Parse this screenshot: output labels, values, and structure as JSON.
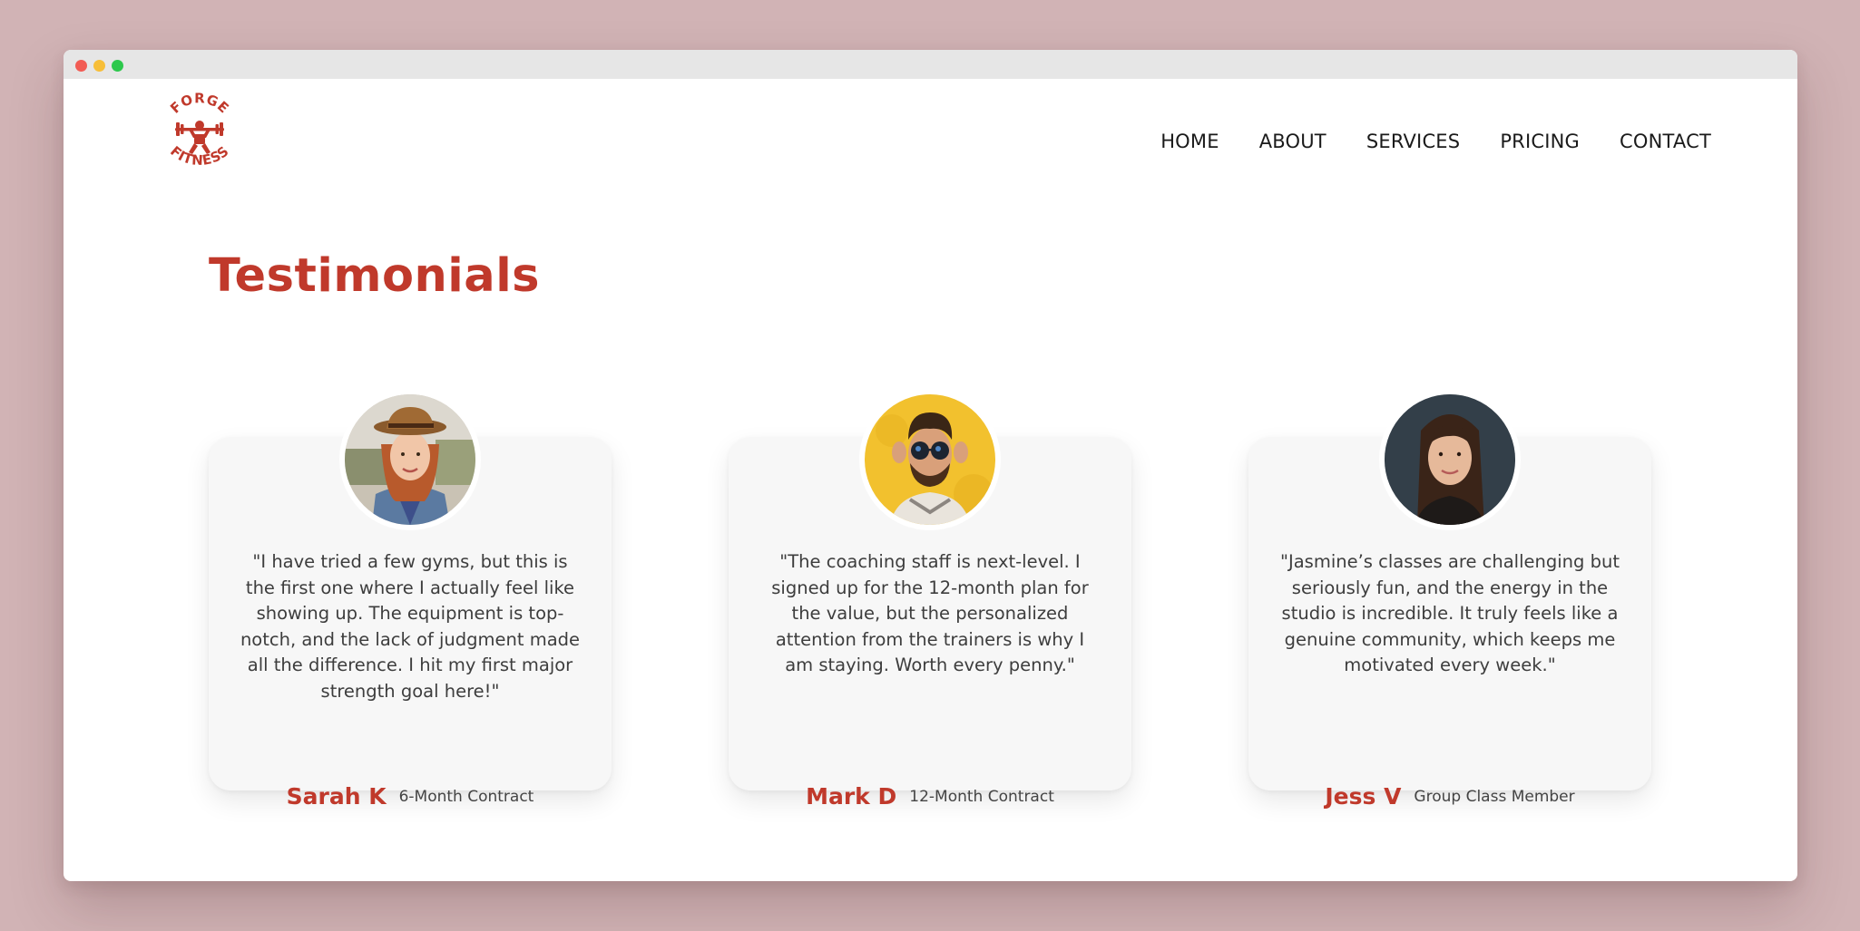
{
  "window": {
    "traffic_lights": [
      "close",
      "minimize",
      "maximize"
    ]
  },
  "logo": {
    "top_text": "FORGE",
    "bottom_text": "FITNESS",
    "icon": "weightlifter-icon",
    "color": "#c0392b"
  },
  "nav": {
    "items": [
      "HOME",
      "ABOUT",
      "SERVICES",
      "PRICING",
      "CONTACT"
    ]
  },
  "section": {
    "title": "Testimonials"
  },
  "colors": {
    "accent": "#c0392b",
    "background": "#d1b3b5",
    "card": "#f7f7f7"
  },
  "testimonials": [
    {
      "quote": "\"I have tried a few gyms, but this is the first one where I actually feel like showing up. The equipment is top-notch, and the lack of judgment made all the difference. I hit my first major strength goal here!\"",
      "name": "Sarah K",
      "plan": "6-Month Contract",
      "avatar": "woman-with-hat-photo"
    },
    {
      "quote": "\"The coaching staff is next-level. I signed up for the 12-month plan for the value, but the personalized attention from the trainers is why I am staying. Worth every penny.\"",
      "name": "Mark D",
      "plan": "12-Month Contract",
      "avatar": "man-with-sunglasses-photo"
    },
    {
      "quote": "\"Jasmine’s classes are challenging but seriously fun, and the energy in the studio is incredible. It truly feels like a genuine community, which keeps me motivated every week.\"",
      "name": "Jess V",
      "plan": "Group Class Member",
      "avatar": "woman-portrait-photo"
    }
  ]
}
